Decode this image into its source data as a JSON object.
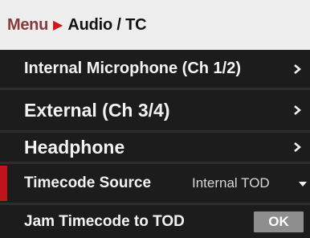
{
  "breadcrumb": {
    "root": "Menu",
    "separator": ">",
    "current": "Audio / TC"
  },
  "menu": {
    "items": [
      {
        "label": "Internal Microphone (Ch 1/2)",
        "icon": "chevron-right-icon"
      },
      {
        "label": "External (Ch 3/4)",
        "icon": "chevron-right-icon"
      },
      {
        "label": "Headphone",
        "icon": "chevron-right-icon"
      },
      {
        "label": "Timecode Source",
        "value": "Internal TOD",
        "icon": "chevron-down-icon"
      },
      {
        "label": "Jam Timecode to TOD",
        "button": "OK"
      }
    ]
  },
  "colors": {
    "accent": "#c0141c",
    "breadcrumb_root": "#8a3a3a",
    "separator": "#d01818",
    "header_bg": "#eeeeee",
    "row_bg": "#1c1c1c",
    "button_bg": "#8e8e8e"
  }
}
